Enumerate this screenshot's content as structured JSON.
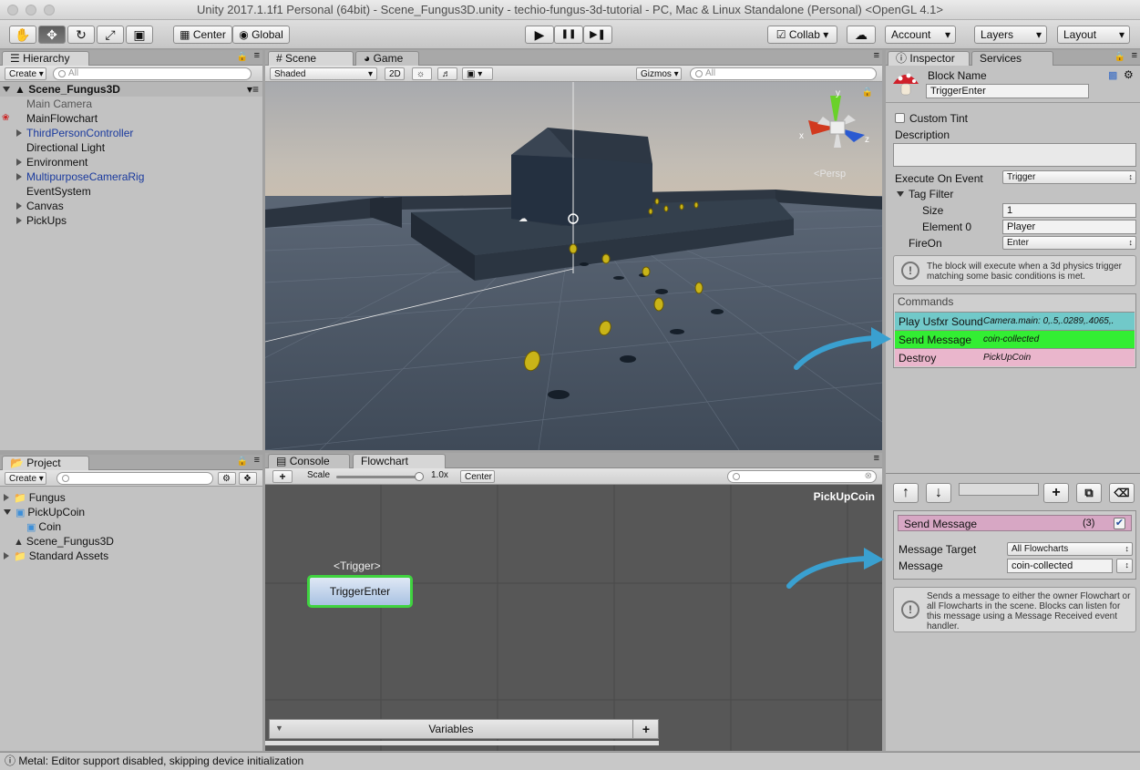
{
  "window": {
    "title": "Unity 2017.1.1f1 Personal (64bit) - Scene_Fungus3D.unity - techio-fungus-3d-tutorial - PC, Mac & Linux Standalone (Personal) <OpenGL 4.1>"
  },
  "toolbar": {
    "tools": [
      {
        "name": "hand-tool",
        "icon": "hand-icon",
        "glyph": "✋"
      },
      {
        "name": "move-tool",
        "icon": "move-icon",
        "glyph": "✥"
      },
      {
        "name": "rotate-tool",
        "icon": "rotate-icon",
        "glyph": "↻"
      },
      {
        "name": "scale-tool",
        "icon": "scale-icon",
        "glyph": "⤢"
      },
      {
        "name": "rect-tool",
        "icon": "rect-icon",
        "glyph": "▣"
      }
    ],
    "pivot_label": "Center",
    "space_label": "Global",
    "play_glyph": "▶",
    "pause_glyph": "❚❚",
    "step_glyph": "▶❚",
    "collab_label": "Collab",
    "cloud_glyph": "☁",
    "account_label": "Account",
    "layers_label": "Layers",
    "layout_label": "Layout"
  },
  "hierarchy": {
    "tab": "Hierarchy",
    "create": "Create",
    "search_placeholder": "All",
    "scene": "Scene_Fungus3D",
    "items": [
      {
        "label": "Main Camera",
        "style": "gray",
        "expand": false
      },
      {
        "label": "MainFlowchart",
        "style": "normal",
        "expand": false
      },
      {
        "label": "ThirdPersonController",
        "style": "blue",
        "expand": true
      },
      {
        "label": "Directional Light",
        "style": "normal",
        "expand": false
      },
      {
        "label": "Environment",
        "style": "normal",
        "expand": true
      },
      {
        "label": "MultipurposeCameraRig",
        "style": "blue",
        "expand": true
      },
      {
        "label": "EventSystem",
        "style": "normal",
        "expand": false
      },
      {
        "label": "Canvas",
        "style": "normal",
        "expand": true
      },
      {
        "label": "PickUps",
        "style": "normal",
        "expand": true
      }
    ]
  },
  "scene_view": {
    "tabs": {
      "scene": "Scene",
      "game": "Game"
    },
    "shading": "Shaded",
    "mode_2d": "2D",
    "gizmos": "Gizmos",
    "search_placeholder": "All",
    "gizmo_axes": {
      "x": "x",
      "y": "y",
      "z": "z"
    },
    "persp": "Persp"
  },
  "project": {
    "tab": "Project",
    "create": "Create",
    "items": [
      {
        "label": "Fungus",
        "indent": 0,
        "kind": "folder",
        "expand": "closed"
      },
      {
        "label": "PickUpCoin",
        "indent": 0,
        "kind": "prefab",
        "expand": "open"
      },
      {
        "label": "Coin",
        "indent": 1,
        "kind": "prefab",
        "expand": "none"
      },
      {
        "label": "Scene_Fungus3D",
        "indent": 0,
        "kind": "scene",
        "expand": "none"
      },
      {
        "label": "Standard Assets",
        "indent": 0,
        "kind": "folder",
        "expand": "closed"
      }
    ]
  },
  "flowchart": {
    "tabs": {
      "console": "Console",
      "flowchart": "Flowchart"
    },
    "add": "+",
    "scale_label": "Scale",
    "scale_value": "1.0x",
    "center": "Center",
    "flowchart_name": "PickUpCoin",
    "block_event": "<Trigger>",
    "block_name": "TriggerEnter",
    "variables_label": "Variables"
  },
  "inspector": {
    "tabs": {
      "inspector": "Inspector",
      "services": "Services"
    },
    "block_name_label": "Block Name",
    "block_name_value": "TriggerEnter",
    "custom_tint": "Custom Tint",
    "description": "Description",
    "execute_on_event_label": "Execute On Event",
    "execute_on_event_value": "Trigger",
    "tag_filter": "Tag Filter",
    "size_label": "Size",
    "size_value": "1",
    "element0_label": "Element 0",
    "element0_value": "Player",
    "fireon_label": "FireOn",
    "fireon_value": "Enter",
    "event_help": "The block will execute when a 3d physics trigger matching some basic conditions is met.",
    "commands_header": "Commands",
    "commands": [
      {
        "name": "Play Usfxr Sound",
        "param": "Camera.main: 0,.5,.0289,.4065,.",
        "color": "#71c9c9"
      },
      {
        "name": "Send Message",
        "param": "coin-collected",
        "color": "#33ee33"
      },
      {
        "name": "Destroy",
        "param": "PickUpCoin",
        "color": "#eab6cc"
      }
    ],
    "cmd_toolbar": {
      "up": "↑",
      "down": "↓",
      "add": "+",
      "dup": "⧉",
      "del": "🗑"
    },
    "selected": {
      "title": "Send Message",
      "index": "(3)",
      "message_target_label": "Message Target",
      "message_target_value": "All Flowcharts",
      "message_label": "Message",
      "message_value": "coin-collected",
      "help": "Sends a message to either the owner Flowchart or all Flowcharts in the scene. Blocks can listen for this message using a Message Received event handler."
    }
  },
  "status": {
    "text": "Metal: Editor support disabled, skipping device initialization"
  },
  "colors": {
    "accent": "#3aa0d0",
    "block_border": "#3fd33f",
    "send_message_header": "#d7a7c4"
  }
}
